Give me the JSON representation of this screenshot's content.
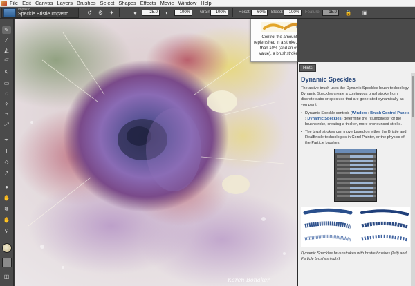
{
  "menu": {
    "items": [
      "File",
      "Edit",
      "Canvas",
      "Layers",
      "Brushes",
      "Select",
      "Shapes",
      "Effects",
      "Movie",
      "Window",
      "Help"
    ]
  },
  "property_bar": {
    "brush_category": "Impasto",
    "brush_variant": "Speckle Bristle Impasto",
    "size_value": "25.0",
    "opacity_value": "100%",
    "grain_label": "Grain:",
    "grain_value": "100%",
    "resat_label": "Resat:",
    "resat_value": "60%",
    "bleed_label": "Bleed:",
    "bleed_value": "100%",
    "feature_label": "Feature:",
    "feature_value": "15.0"
  },
  "tooltip": {
    "text": "Control the amount of color that is replenished in a stroke. With a value lower than 10% (and an even lower Bleed value), a brushstroke fades in gently."
  },
  "panel": {
    "tab_label": "Hints",
    "title": "Dynamic Speckles",
    "intro": "The active brush uses the Dynamic Speckles brush technology. Dynamic Speckles create a continuous brushstroke from discrete dabs or speckles that are generated dynamically as you paint.",
    "bullet1_prefix": "Dynamic Speckle controls (",
    "bullet1_link1": "Window",
    "bullet1_sep1": " › ",
    "bullet1_link2": "Brush Control Panels",
    "bullet1_sep2": " › ",
    "bullet1_link3": "Dynamic Speckles",
    "bullet1_suffix": ") determine the \"clumpiness\" of the brushstroke, creating a thicker, more pronounced stroke.",
    "bullet2": "The brushstrokes can move based on either the Bristle and RealBristle technologies in Corel Painter, or the physics of the Particle brushes.",
    "caption": "Dynamic Speckles brushstrokes with bristle brushes (left) and Particle brushes (right)"
  },
  "canvas": {
    "signature": "Karen Bonaker"
  },
  "colors": {
    "accent": "#2d4c7d",
    "link": "#2a5b9c",
    "panel_bg": "#f0f0f0",
    "toolbar_bg": "#4a4a4a"
  },
  "icons": [
    "brush-icon",
    "eyedropper-icon",
    "paint-bucket-icon",
    "eraser-icon",
    "lasso-icon",
    "selection-icon",
    "crop-icon",
    "transform-icon",
    "text-icon",
    "shape-icon",
    "hand-icon",
    "magnifier-icon",
    "rotate-icon",
    "lock-icon",
    "home-icon"
  ]
}
